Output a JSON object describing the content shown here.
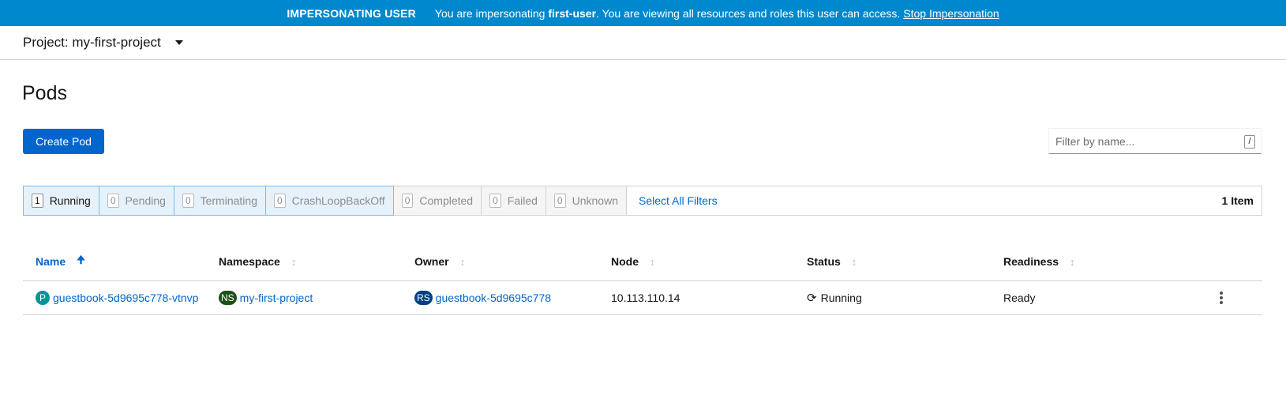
{
  "banner": {
    "tag": "IMPERSONATING USER",
    "message_prefix": "You are impersonating ",
    "user": "first-user",
    "message_suffix": ". You are viewing all resources and roles this user can access.",
    "stop_label": "Stop Impersonation",
    "color": "#0088ce"
  },
  "project": {
    "label": "Project: my-first-project"
  },
  "page": {
    "title": "Pods",
    "create_label": "Create Pod",
    "filter_placeholder": "Filter by name...",
    "filter_shortcut": "/"
  },
  "row_filters": [
    {
      "count": "1",
      "label": "Running"
    },
    {
      "count": "0",
      "label": "Pending"
    },
    {
      "count": "0",
      "label": "Terminating"
    },
    {
      "count": "0",
      "label": "CrashLoopBackOff"
    },
    {
      "count": "0",
      "label": "Completed"
    },
    {
      "count": "0",
      "label": "Failed"
    },
    {
      "count": "0",
      "label": "Unknown"
    }
  ],
  "select_all_label": "Select All Filters",
  "item_count": "1 Item",
  "table": {
    "columns": [
      "Name",
      "Namespace",
      "Owner",
      "Node",
      "Status",
      "Readiness"
    ],
    "rows": [
      {
        "name_badge": "P",
        "name": "guestbook-5d9695c778-vtnvp",
        "namespace_badge": "NS",
        "namespace": "my-first-project",
        "owner_badge": "RS",
        "owner": "guestbook-5d9695c778",
        "node": "10.113.110.14",
        "status": "Running",
        "readiness": "Ready"
      }
    ]
  },
  "colors": {
    "primary": "#0066cc",
    "pod_badge": "#009596",
    "ns_badge": "#1e4f18",
    "rs_badge": "#004080"
  }
}
